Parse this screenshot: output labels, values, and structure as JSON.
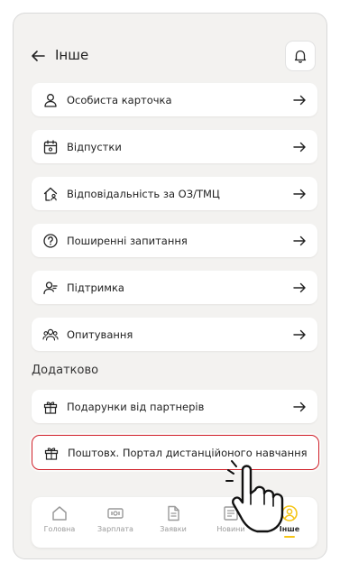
{
  "header": {
    "title": "Інше"
  },
  "menu_items": [
    {
      "label": "Особиста карточка",
      "icon": "person-icon"
    },
    {
      "label": "Відпустки",
      "icon": "calendar-icon"
    },
    {
      "label": "Відповідальність за ОЗ/ТМЦ",
      "icon": "house-person-icon"
    },
    {
      "label": "Поширенні запитання",
      "icon": "question-icon"
    },
    {
      "label": "Підтримка",
      "icon": "person-support-icon"
    },
    {
      "label": "Опитування",
      "icon": "group-icon"
    }
  ],
  "section": {
    "title": "Додатково"
  },
  "extra_items": [
    {
      "label": "Подарунки від партнерів",
      "icon": "gift-icon"
    },
    {
      "label": "Поштовх. Портал дистанційоного навчання",
      "icon": "gift-icon"
    }
  ],
  "bottom_nav": [
    {
      "label": "Головна",
      "icon": "home-icon",
      "active": false
    },
    {
      "label": "Зарплата",
      "icon": "money-icon",
      "active": false
    },
    {
      "label": "Заявки",
      "icon": "document-icon",
      "active": false
    },
    {
      "label": "Новини",
      "icon": "news-icon",
      "active": false
    },
    {
      "label": "Інше",
      "icon": "profile-icon",
      "active": true
    }
  ],
  "colors": {
    "accent": "#f5c517",
    "highlight": "#d0202a",
    "background": "#f3f2f0"
  }
}
